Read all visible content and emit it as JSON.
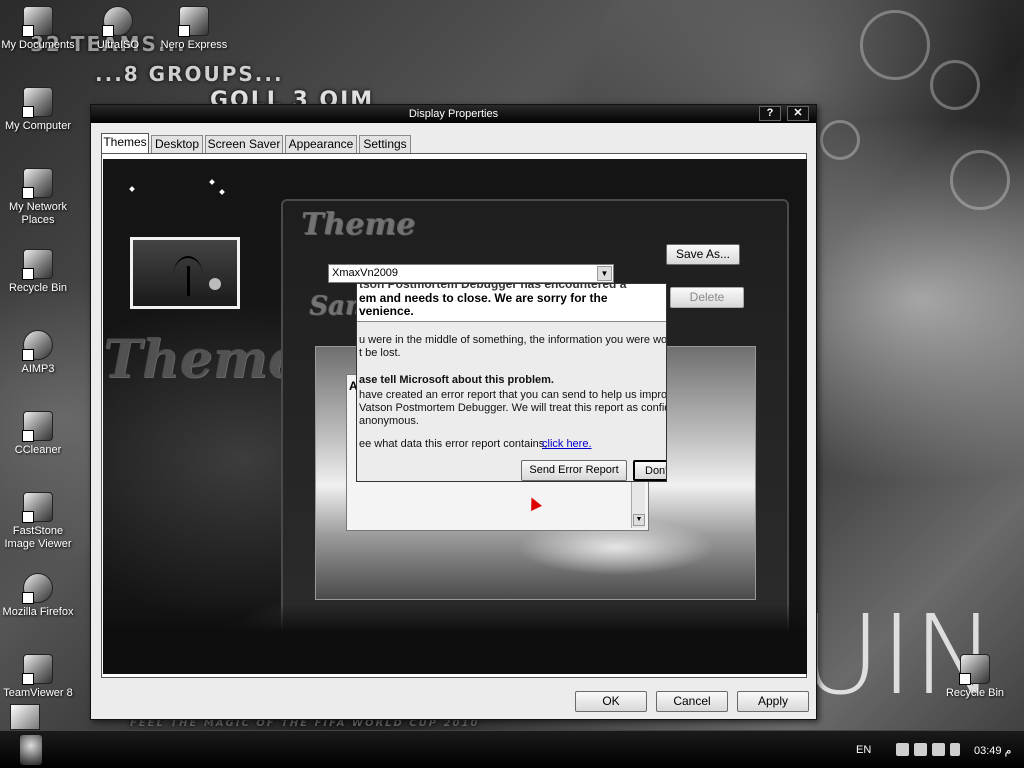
{
  "wallpaper": {
    "line1": "32 TEAMS...",
    "line2": "...8 GROUPS...",
    "line3": "GOLL 3 OIM",
    "bottom_caption": "FEEL THE MAGIC OF THE FIFA WORLD CUP 2010",
    "big_letters": "UIN"
  },
  "desktop_icons": [
    {
      "label": "My Documents",
      "icon": "folder-icon"
    },
    {
      "label": "UltraISO",
      "icon": "disc-icon"
    },
    {
      "label": "Nero Express",
      "icon": "nero-icon"
    },
    {
      "label": "My Computer",
      "icon": "computer-icon"
    },
    {
      "label": "My Network Places",
      "icon": "network-icon"
    },
    {
      "label": "Recycle Bin",
      "icon": "recycle-bin-icon"
    },
    {
      "label": "AIMP3",
      "icon": "aimp-icon"
    },
    {
      "label": "CCleaner",
      "icon": "ccleaner-icon"
    },
    {
      "label": "FastStone Image Viewer",
      "icon": "faststone-icon"
    },
    {
      "label": "Mozilla Firefox",
      "icon": "firefox-icon"
    },
    {
      "label": "TeamViewer 8",
      "icon": "teamviewer-icon"
    },
    {
      "label": "Recycle Bin",
      "icon": "recycle-bin-icon"
    }
  ],
  "dialog": {
    "title": "Display Properties",
    "help_label": "?",
    "close_label": "✕",
    "tabs": [
      "Themes",
      "Desktop",
      "Screen Saver",
      "Appearance",
      "Settings"
    ],
    "active_tab": "Themes",
    "art_word": "Themes",
    "theme_heading": "Theme",
    "sample_heading": "Sample",
    "theme_select_value": "XmaxVn2009",
    "save_as_label": "Save As...",
    "delete_label": "Delete",
    "ok_label": "OK",
    "cancel_label": "Cancel",
    "apply_label": "Apply",
    "sample_window_label": "A"
  },
  "error_dialog": {
    "line0": "tson Postmortem Debugger has encountered a",
    "line1": "em and needs to close.  We are sorry for the",
    "line2": "venience.",
    "para1a": "u were in the middle of something, the information you were workin",
    "para1b": "t be lost.",
    "heading": "ase tell Microsoft about this problem.",
    "para2a": "have created an error report that you can send to help us improve",
    "para2b": "Vatson Postmortem Debugger.  We will treat this report as confiden",
    "para2c": "anonymous.",
    "para3": "ee what data this error report contains,",
    "link": "click here.",
    "send_label": "Send Error Report",
    "dont_send_label": "Don't"
  },
  "taskbar": {
    "language": "EN",
    "time": "03:49 م"
  }
}
